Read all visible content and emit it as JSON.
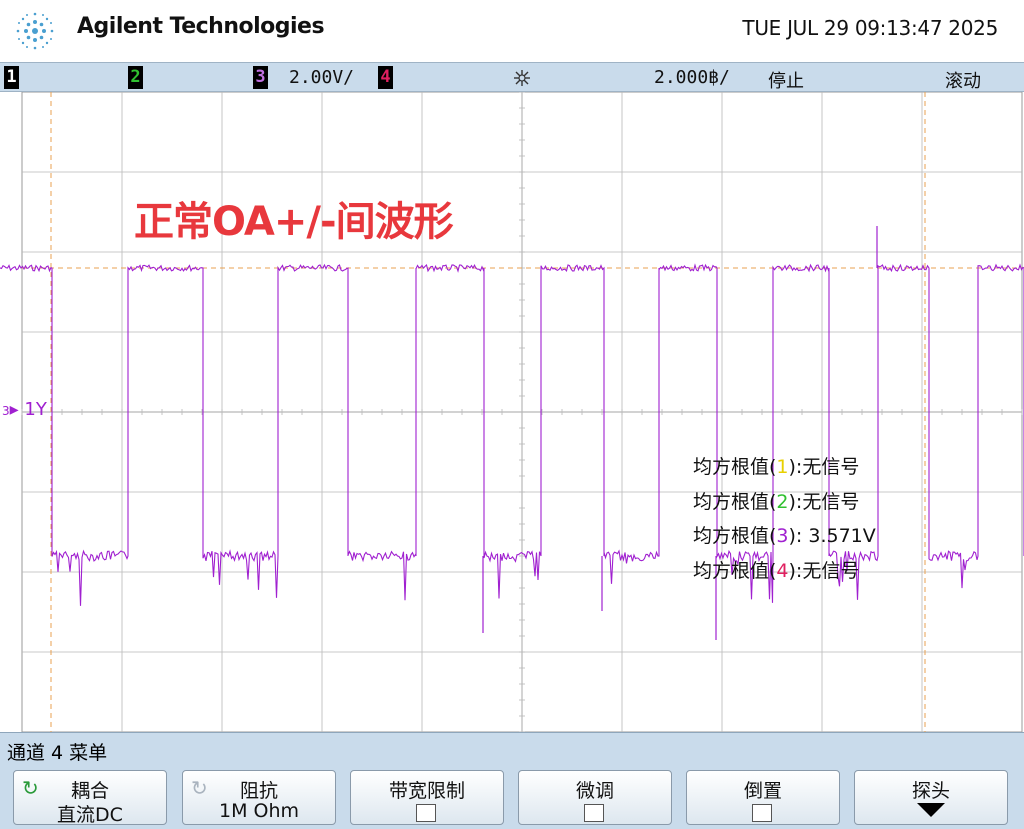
{
  "header": {
    "brand": "Agilent Technologies",
    "datetime": "TUE JUL 29 09:13:47 2025"
  },
  "statusbar": {
    "channels": [
      {
        "num": "1",
        "color": "#e8d000"
      },
      {
        "num": "2",
        "color": "#30c030"
      },
      {
        "num": "3",
        "color": "#a020d0"
      },
      {
        "num": "4",
        "color": "#e02060"
      }
    ],
    "ch3_scale": "2.00V/",
    "timebase": "2.000฿/",
    "run_state": "停止",
    "mode": "滚动"
  },
  "screen": {
    "annotation": "正常OA+/-间波形",
    "channel_marker_num": "3",
    "channel_marker_label": "1Y",
    "trace_color": "#a020d0",
    "grid_color": "#b8b8b8",
    "cursor_color": "#e8a050",
    "measurements": [
      {
        "prefix": "均方根值(",
        "ch": "1",
        "suffix": "):无信号"
      },
      {
        "prefix": "均方根值(",
        "ch": "2",
        "suffix": "):无信号"
      },
      {
        "prefix": "均方根值(",
        "ch": "3",
        "suffix": "): 3.571V"
      },
      {
        "prefix": "均方根值(",
        "ch": "4",
        "suffix": "):无信号"
      }
    ]
  },
  "menu": {
    "title": "通道 4 菜单",
    "softkeys": [
      {
        "l1": "耦合",
        "l2": "直流DC",
        "icon": "rotate-icon",
        "active": true
      },
      {
        "l1": "阻抗",
        "l2": "1M Ohm",
        "icon": "rotate-icon",
        "active": false
      },
      {
        "l1": "带宽限制",
        "l2": "",
        "checkbox": true
      },
      {
        "l1": "微调",
        "l2": "",
        "checkbox": true
      },
      {
        "l1": "倒置",
        "l2": "",
        "checkbox": true
      },
      {
        "l1": "探头",
        "l2": "",
        "arrow": true
      }
    ]
  },
  "waveform": {
    "high_level_px_note": "square wave channel 3",
    "transitions": [
      0,
      52,
      128,
      203,
      278,
      348,
      416,
      484,
      541,
      604,
      659,
      717,
      773,
      829,
      878,
      929,
      978,
      1024
    ]
  }
}
